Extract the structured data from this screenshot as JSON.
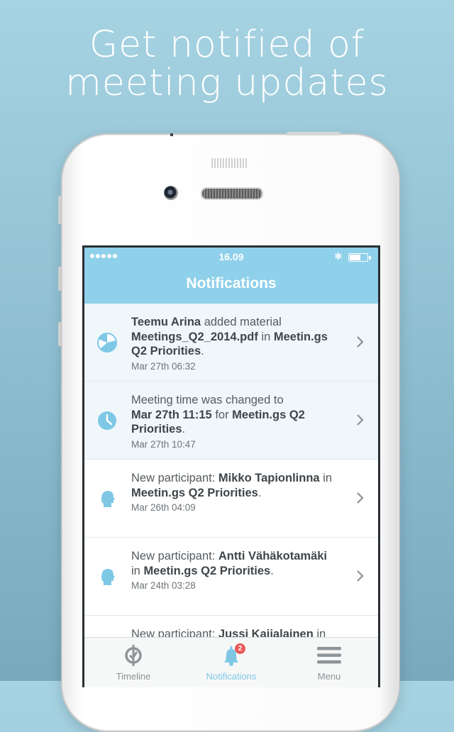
{
  "promo": {
    "headline_line1": "Get notified of",
    "headline_line2": "meeting updates"
  },
  "status_bar": {
    "time": "16.09",
    "signal_dots": 5,
    "bluetooth_icon": "bluetooth-icon",
    "battery_level": 0.7
  },
  "nav": {
    "title": "Notifications"
  },
  "notifications": [
    {
      "icon": "pie-chart-icon",
      "unread": true,
      "actor": "Teemu Arina",
      "action": " added material",
      "object": "Meetings_Q2_2014.pdf",
      "connector": " in ",
      "meeting": "Meetin.gs Q2 Priorities",
      "end": ".",
      "time": "Mar 27th 06:32"
    },
    {
      "icon": "clock-icon",
      "unread": true,
      "prefix": "Meeting time was changed to",
      "new_time": "Mar 27th 11:15",
      "connector": " for ",
      "meeting": "Meetin.gs Q2 Priorities",
      "end": ".",
      "time": "Mar 27th 10:47"
    },
    {
      "icon": "person-icon",
      "unread": false,
      "prefix": "New participant: ",
      "participant": "Mikko Tapionlinna",
      "connector": " in",
      "meeting": "Meetin.gs Q2 Priorities",
      "end": ".",
      "time": "Mar 26th 04:09"
    },
    {
      "icon": "person-icon",
      "unread": false,
      "prefix": "New participant: ",
      "participant": "Antti Vähäkotamäki",
      "connector": "in ",
      "meeting": "Meetin.gs Q2 Priorities",
      "end": ".",
      "time": "Mar 24th 03:28"
    },
    {
      "icon": "person-icon",
      "unread": false,
      "prefix": "New participant: ",
      "participant": "Jussi Kajjalainen",
      "connector": " in"
    }
  ],
  "tab_bar": {
    "tabs": [
      {
        "label": "Timeline",
        "icon": "timeline-icon",
        "active": false
      },
      {
        "label": "Notifications",
        "icon": "bell-icon",
        "active": true,
        "badge": "2"
      },
      {
        "label": "Menu",
        "icon": "hamburger-menu-icon",
        "active": false
      }
    ]
  },
  "colors": {
    "accent": "#8fd0ea",
    "icon": "#7ec8e6",
    "badge": "#e65a57",
    "unread_bg": "#eff7fb"
  }
}
